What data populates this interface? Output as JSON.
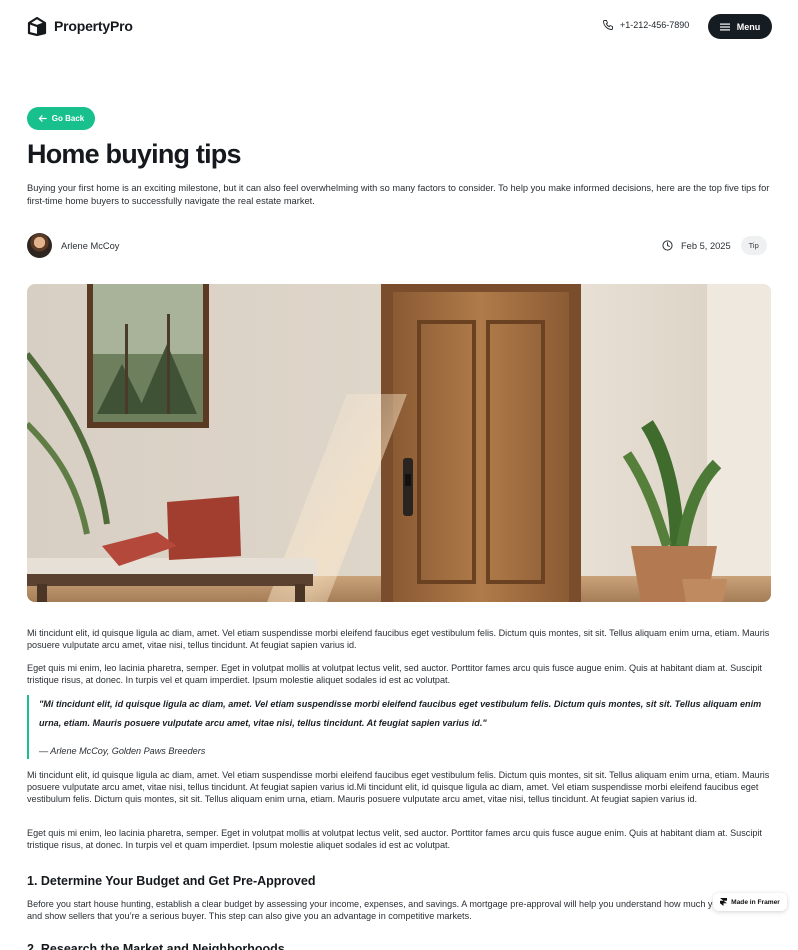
{
  "header": {
    "brand": "PropertyPro",
    "phone": "+1-212-456-7890",
    "menu_label": "Menu"
  },
  "article": {
    "back_label": "Go Back",
    "title": "Home buying tips",
    "intro": "Buying your first home is an exciting milestone, but it can also feel overwhelming with so many factors to consider. To help you make informed decisions, here are the top  five tips for first-time home buyers to successfully navigate the real estate market.",
    "author": "Arlene McCoy",
    "date": "Feb 5, 2025",
    "tag": "Tip",
    "paragraphs": [
      "Mi tincidunt elit, id quisque ligula ac diam, amet. Vel etiam suspendisse morbi eleifend faucibus eget vestibulum felis. Dictum quis montes, sit sit. Tellus aliquam enim urna, etiam. Mauris posuere vulputate arcu amet, vitae nisi, tellus tincidunt. At feugiat sapien varius id.",
      "Eget quis mi enim, leo lacinia pharetra, semper. Eget in volutpat mollis at volutpat lectus velit, sed auctor. Porttitor fames arcu quis fusce augue enim. Quis at habitant diam at. Suscipit tristique risus, at donec. In turpis vel et quam imperdiet. Ipsum molestie aliquet sodales id est ac volutpat.",
      "Mi tincidunt elit, id quisque ligula ac diam, amet. Vel etiam suspendisse morbi eleifend faucibus eget vestibulum felis. Dictum quis montes, sit sit. Tellus aliquam enim urna, etiam. Mauris posuere vulputate arcu amet, vitae nisi, tellus tincidunt. At feugiat sapien varius id.Mi tincidunt elit, id quisque ligula ac diam, amet. Vel etiam suspendisse morbi eleifend faucibus eget vestibulum felis. Dictum quis montes, sit sit. Tellus aliquam enim urna, etiam. Mauris posuere vulputate arcu amet, vitae nisi, tellus tincidunt. At feugiat sapien varius id.",
      "Eget quis mi enim, leo lacinia pharetra, semper. Eget in volutpat mollis at volutpat lectus velit, sed auctor. Porttitor fames arcu quis fusce augue enim. Quis at habitant diam at. Suscipit tristique risus, at donec. In turpis vel et quam imperdiet. Ipsum molestie aliquet sodales id est ac volutpat."
    ],
    "quote": "\"Mi tincidunt elit, id quisque ligula ac diam, amet. Vel etiam suspendisse morbi eleifend faucibus eget vestibulum felis. Dictum quis montes, sit sit. Tellus aliquam enim urna, etiam. Mauris posuere vulputate arcu amet, vitae nisi, tellus tincidunt. At feugiat sapien varius id.\"",
    "quote_cite": "— Arlene McCoy, Golden Paws Breeders",
    "section1_heading": "1. Determine Your Budget and Get Pre-Approved",
    "section1_text": "Before you start house hunting, establish a clear budget by assessing your income, expenses, and savings. A mortgage pre-approval will help you understand how much you can afford and show sellers that you’re a serious buyer. This step can also give you an advantage in competitive markets.",
    "section2_heading": "2. Research the Market and Neighborhoods"
  },
  "badge": {
    "label": "Made in Framer"
  },
  "colors": {
    "accent": "#17c08d",
    "dark": "#151c22"
  },
  "icons": {
    "logo": "house-cube-icon",
    "phone": "phone-icon",
    "menu": "hamburger-icon",
    "back": "arrow-left-icon",
    "date": "clock-icon",
    "badge": "framer-icon"
  }
}
